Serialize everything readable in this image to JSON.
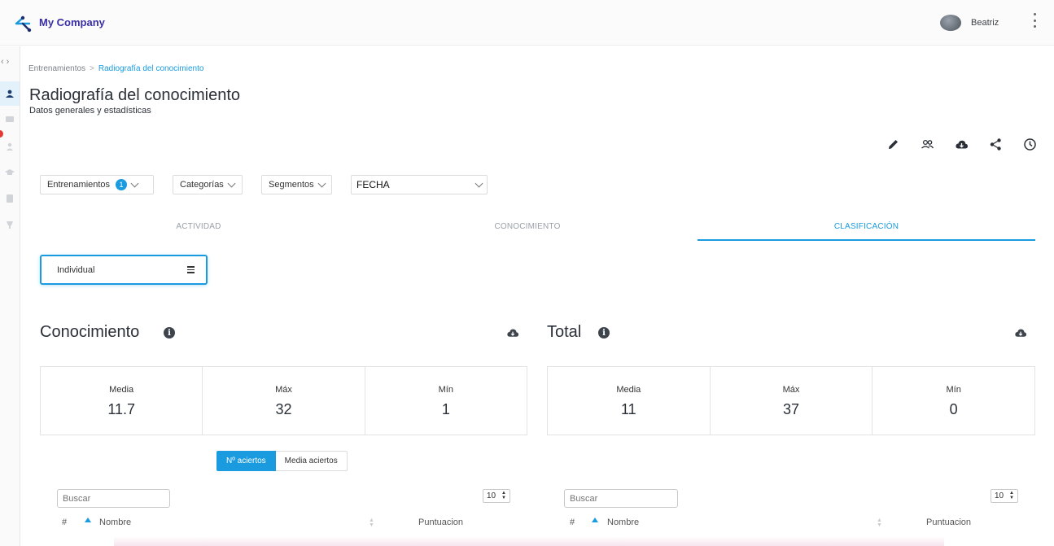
{
  "app": {
    "brand": "My Company",
    "user": "Beatriz"
  },
  "breadcrumb": {
    "root": "Entrenamientos",
    "separator": ">",
    "current": "Radiografía del conocimiento"
  },
  "page": {
    "title": "Radiografía del conocimiento",
    "subtitle": "Datos generales y estadísticas"
  },
  "toolbar": [
    "pencil-icon",
    "users-icon",
    "cloud-download-icon",
    "share-icon",
    "clock-icon"
  ],
  "filters": {
    "trainings": {
      "label": "Entrenamientos",
      "count": "1"
    },
    "categories": {
      "label": "Categorías"
    },
    "segments": {
      "label": "Segmentos"
    },
    "date": {
      "label": "FECHA"
    }
  },
  "tabs": [
    {
      "label": "ACTIVIDAD",
      "active": false
    },
    {
      "label": "CONOCIMIENTO",
      "active": false
    },
    {
      "label": "CLASIFICACIÓN",
      "active": true
    }
  ],
  "view_select": {
    "value": "Individual"
  },
  "sections": {
    "knowledge": {
      "title": "Conocimiento",
      "stats": [
        {
          "label": "Media",
          "value": "11.7"
        },
        {
          "label": "Máx",
          "value": "32"
        },
        {
          "label": "Mín",
          "value": "1"
        }
      ],
      "search_placeholder": "Buscar",
      "page_size": "10",
      "columns": {
        "index": "#",
        "name": "Nombre",
        "score": "Puntuacion"
      }
    },
    "total": {
      "title": "Total",
      "stats": [
        {
          "label": "Media",
          "value": "11"
        },
        {
          "label": "Máx",
          "value": "37"
        },
        {
          "label": "Mín",
          "value": "0"
        }
      ],
      "search_placeholder": "Buscar",
      "page_size": "10",
      "columns": {
        "index": "#",
        "name": "Nombre",
        "score": "Puntuacion"
      }
    }
  },
  "segmented": {
    "hits": "Nº aciertos",
    "avg_hits": "Media aciertos"
  },
  "colors": {
    "accent": "#1a9be0",
    "brand": "#3a2fa6",
    "alert": "#e53935"
  }
}
